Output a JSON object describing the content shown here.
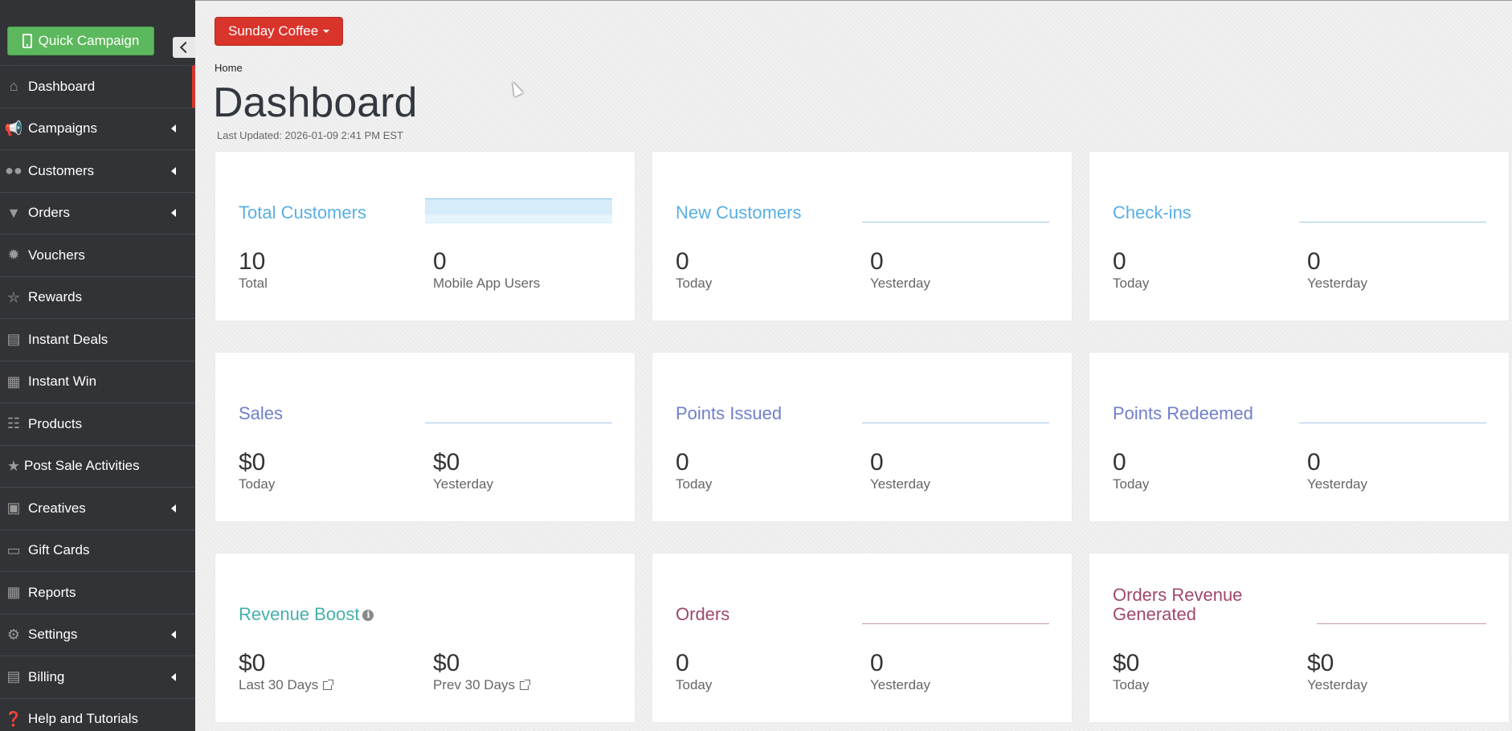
{
  "sidebar": {
    "quick_campaign_label": "Quick Campaign",
    "items": [
      {
        "label": "Dashboard",
        "icon": "home-icon",
        "has_submenu": false,
        "active": true
      },
      {
        "label": "Campaigns",
        "icon": "megaphone-icon",
        "has_submenu": true
      },
      {
        "label": "Customers",
        "icon": "users-icon",
        "has_submenu": true
      },
      {
        "label": "Orders",
        "icon": "glass-icon",
        "has_submenu": true
      },
      {
        "label": "Vouchers",
        "icon": "certificate-icon",
        "has_submenu": false
      },
      {
        "label": "Rewards",
        "icon": "trophy-icon",
        "has_submenu": false
      },
      {
        "label": "Instant Deals",
        "icon": "money-icon",
        "has_submenu": false
      },
      {
        "label": "Instant Win",
        "icon": "gift-icon",
        "has_submenu": false
      },
      {
        "label": "Products",
        "icon": "cart-icon",
        "has_submenu": false
      },
      {
        "label": "Post Sale Activities",
        "icon": "star-icon",
        "has_submenu": false
      },
      {
        "label": "Creatives",
        "icon": "image-icon",
        "has_submenu": true
      },
      {
        "label": "Gift Cards",
        "icon": "credit-card-icon",
        "has_submenu": false
      },
      {
        "label": "Reports",
        "icon": "table-icon",
        "has_submenu": false
      },
      {
        "label": "Settings",
        "icon": "gear-icon",
        "has_submenu": true
      },
      {
        "label": "Billing",
        "icon": "money-icon",
        "has_submenu": true
      },
      {
        "label": "Help and Tutorials",
        "icon": "question-icon",
        "has_submenu": false
      }
    ]
  },
  "header": {
    "store_selector": "Sunday Coffee",
    "breadcrumb": "Home",
    "title": "Dashboard",
    "last_updated": "Last Updated: 2026-01-09 2:41 PM EST"
  },
  "cards": {
    "total_customers": {
      "title": "Total Customers",
      "left_value": "10",
      "left_label": "Total",
      "right_value": "0",
      "right_label": "Mobile App Users"
    },
    "new_customers": {
      "title": "New Customers",
      "left_value": "0",
      "left_label": "Today",
      "right_value": "0",
      "right_label": "Yesterday"
    },
    "check_ins": {
      "title": "Check-ins",
      "left_value": "0",
      "left_label": "Today",
      "right_value": "0",
      "right_label": "Yesterday"
    },
    "sales": {
      "title": "Sales",
      "left_value": "$0",
      "left_label": "Today",
      "right_value": "$0",
      "right_label": "Yesterday"
    },
    "points_issued": {
      "title": "Points Issued",
      "left_value": "0",
      "left_label": "Today",
      "right_value": "0",
      "right_label": "Yesterday"
    },
    "points_redeemed": {
      "title": "Points Redeemed",
      "left_value": "0",
      "left_label": "Today",
      "right_value": "0",
      "right_label": "Yesterday"
    },
    "revenue_boost": {
      "title": "Revenue Boost",
      "left_value": "$0",
      "left_label": "Last 30 Days",
      "right_value": "$0",
      "right_label": "Prev 30 Days"
    },
    "orders": {
      "title": "Orders",
      "left_value": "0",
      "left_label": "Today",
      "right_value": "0",
      "right_label": "Yesterday"
    },
    "orders_revenue": {
      "title": "Orders Revenue Generated",
      "left_value": "$0",
      "left_label": "Today",
      "right_value": "$0",
      "right_label": "Yesterday"
    }
  },
  "colors": {
    "sidebar_bg": "#323337",
    "quick_campaign_green": "#5cb85c",
    "store_button_red": "#d9342b",
    "title_blue": "#5aafe4",
    "title_indigo": "#6f7fc9",
    "title_teal": "#45b0ab",
    "title_plum": "#a0476e"
  }
}
